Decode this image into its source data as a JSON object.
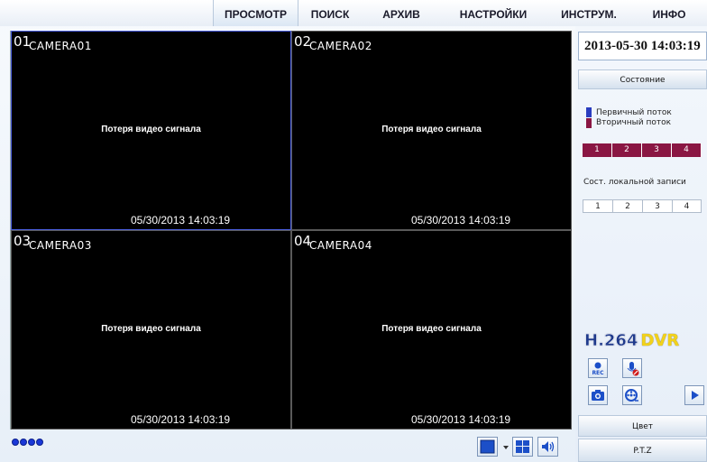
{
  "nav": {
    "tabs": [
      {
        "label": "ПРОСМОТР",
        "active": true
      },
      {
        "label": "ПОИСК",
        "active": false
      },
      {
        "label": "АРХИВ",
        "active": false
      },
      {
        "label": "НАСТРОЙКИ",
        "active": false
      },
      {
        "label": "ИНСТРУМ.",
        "active": false
      },
      {
        "label": "ИНФО",
        "active": false
      }
    ]
  },
  "cameras": [
    {
      "num": "01",
      "name": "CAMERA01",
      "message": "Потеря видео сигнала",
      "time": "05/30/2013 14:03:19",
      "selected": true
    },
    {
      "num": "02",
      "name": "CAMERA02",
      "message": "Потеря видео сигнала",
      "time": "05/30/2013 14:03:19",
      "selected": false
    },
    {
      "num": "03",
      "name": "CAMERA03",
      "message": "Потеря видео сигнала",
      "time": "05/30/2013 14:03:19",
      "selected": false
    },
    {
      "num": "04",
      "name": "CAMERA04",
      "message": "Потеря видео сигнала",
      "time": "05/30/2013 14:03:19",
      "selected": false
    }
  ],
  "side": {
    "datetime": "2013-05-30 14:03:19",
    "status_label": "Состояние",
    "legend": {
      "primary": "Первичный поток",
      "secondary": "Вторичный поток"
    },
    "stream_channels": [
      "1",
      "2",
      "3",
      "4"
    ],
    "record_title": "Сост. локальной записи",
    "record_channels": [
      "1",
      "2",
      "3",
      "4"
    ],
    "logo_h264": "H.264",
    "logo_dvr": "DVR",
    "rec_label": "REC",
    "color_label": "Цвет",
    "ptz_label": "P.T.Z"
  },
  "colors": {
    "primary": "#2a3dbf",
    "secondary": "#8a1643",
    "accent": "#1a38d8"
  },
  "icons": [
    "rec-icon",
    "mic-mute-icon",
    "snapshot-icon",
    "playback-icon",
    "play-icon",
    "single-view-icon",
    "quad-view-icon",
    "volume-icon",
    "dropdown-arrow-icon"
  ]
}
